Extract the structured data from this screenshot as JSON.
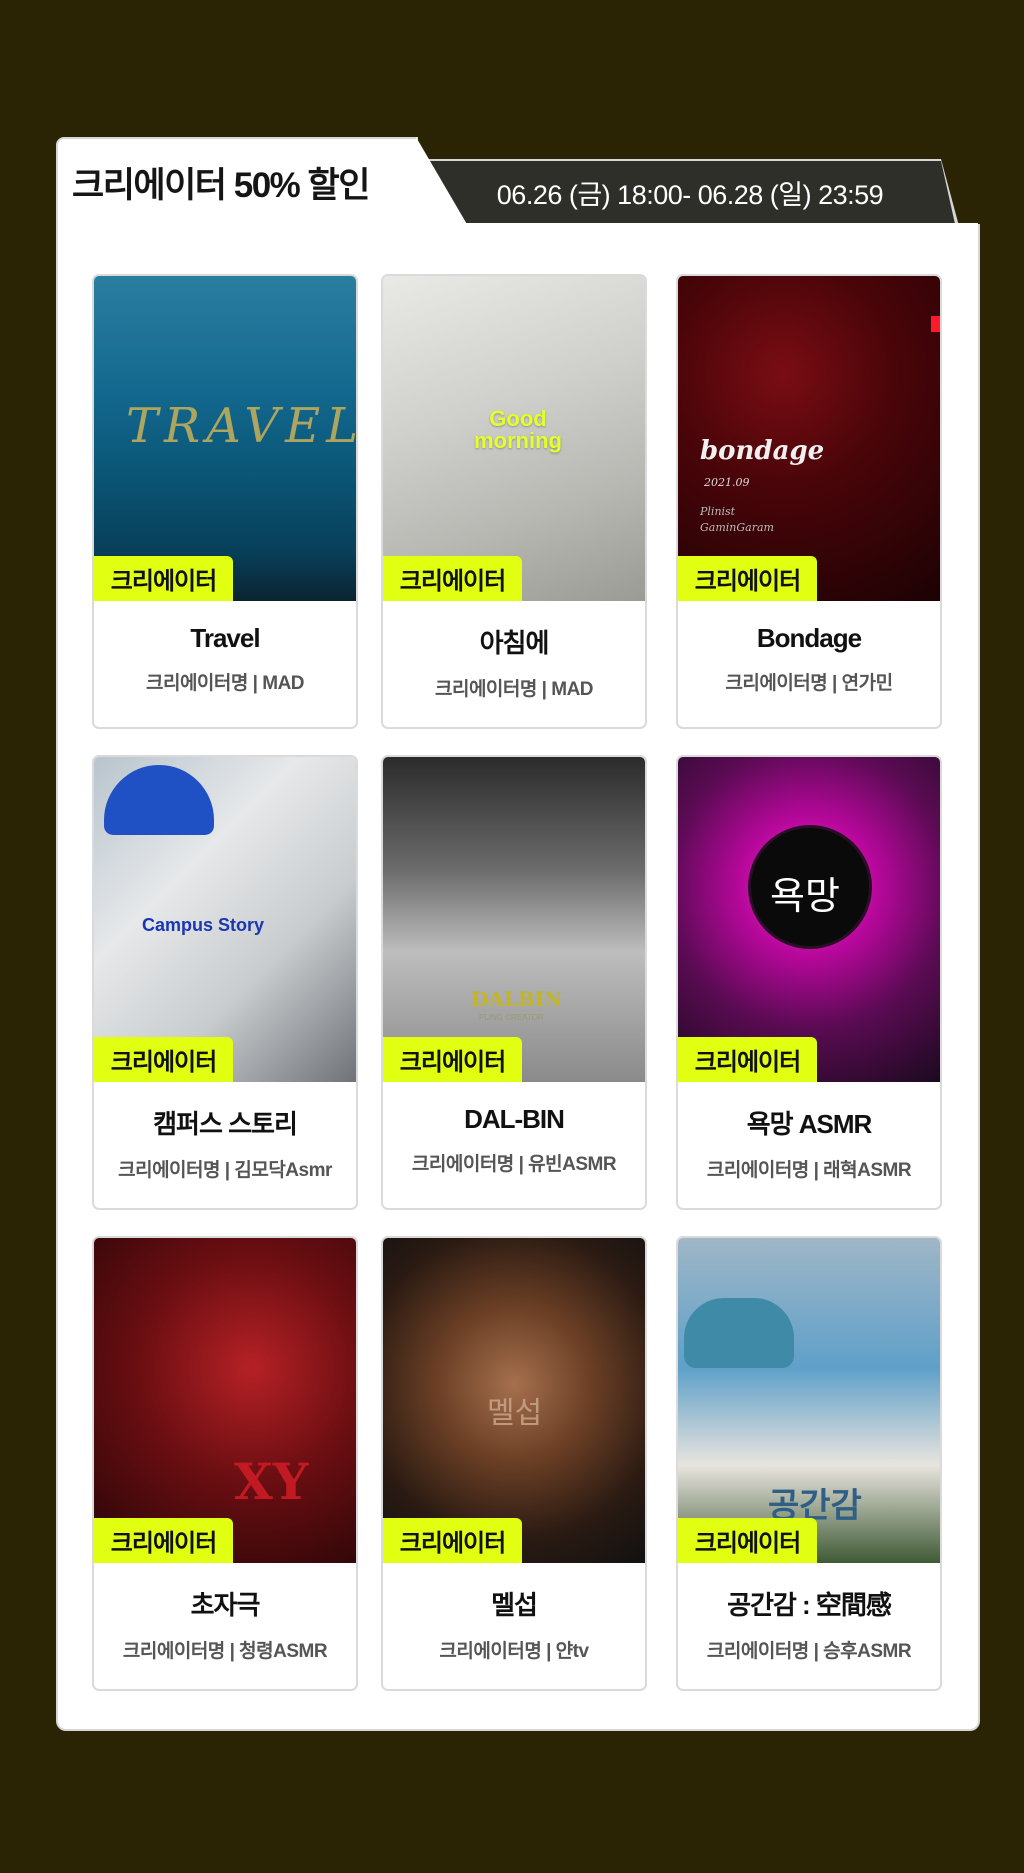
{
  "header": {
    "title": "크리에이터 50% 할인",
    "period": "06.26 (금) 18:00- 06.28 (일) 23:59"
  },
  "badge_label": "크리에이터",
  "colors": {
    "background": "#2b2404",
    "badge": "#e0ff11",
    "date_tab": "#2e2f29"
  },
  "cards": [
    {
      "title": "Travel",
      "subtitle": "크리에이터명 | MAD",
      "cover_text": "TRAVEL"
    },
    {
      "title": "아침에",
      "subtitle": "크리에이터명 | MAD",
      "cover_text": "Good morning"
    },
    {
      "title": "Bondage",
      "subtitle": "크리에이터명 | 연가민",
      "cover_text": "bondage",
      "cover_date": "2021.09",
      "cover_credit": "Plinist GaminGaram"
    },
    {
      "title": "캠퍼스 스토리",
      "subtitle": "크리에이터명 | 김모닥Asmr",
      "cover_text": "Campus Story"
    },
    {
      "title": "DAL-BIN",
      "subtitle": "크리에이터명 | 유빈ASMR",
      "cover_text": "DALBIN",
      "cover_credit": "PLING CREATOR"
    },
    {
      "title": "욕망 ASMR",
      "subtitle": "크리에이터명 | 래혁ASMR",
      "cover_text": "욕망"
    },
    {
      "title": "초자극",
      "subtitle": "크리에이터명 | 청령ASMR",
      "cover_text": "XY"
    },
    {
      "title": "멜섭",
      "subtitle": "크리에이터명 | 얀tv",
      "cover_text": "멜섭"
    },
    {
      "title": "공간감 : 空間感",
      "subtitle": "크리에이터명 | 승후ASMR",
      "cover_text": "공간감"
    }
  ]
}
